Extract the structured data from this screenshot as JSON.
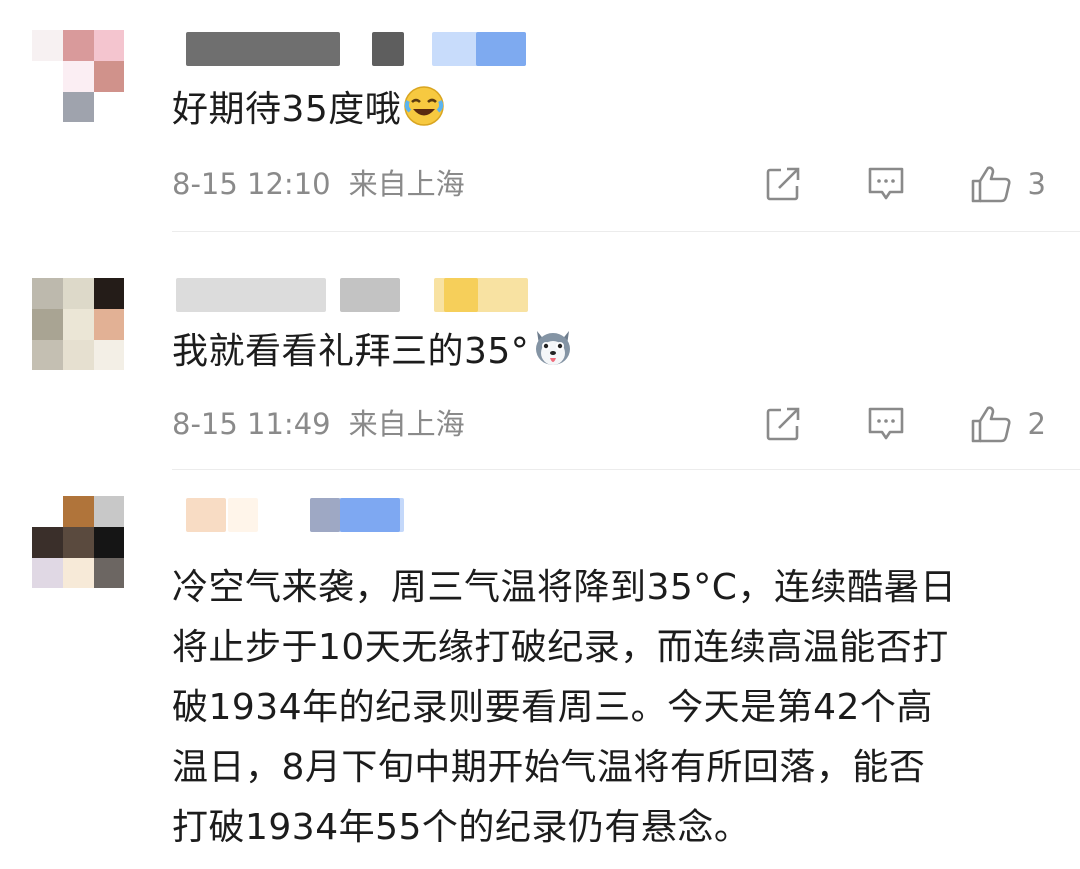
{
  "comments": [
    {
      "text": "好期待35度哦",
      "emoji": "laughing-crying-emoji",
      "time": "8-15 12:10",
      "location": "来自上海",
      "likes": "3"
    },
    {
      "text": "我就看看礼拜三的35°",
      "emoji": "husky-dog-emoji",
      "time": "8-15 11:49",
      "location": "来自上海",
      "likes": "2"
    },
    {
      "lines": [
        "冷空气来袭，周三气温将降到35°C，连续酷暑日",
        "将止步于10天无缘打破纪录，而连续高温能否打",
        "破1934年的纪录则要看周三。今天是第42个高",
        "温日，8月下旬中期开始气温将有所回落，能否",
        "打破1934年55个的纪录仍有悬念。"
      ]
    }
  ],
  "icons": {
    "share": "share-icon",
    "reply": "comment-icon",
    "like": "thumbs-up-icon"
  },
  "colors": {
    "meta": "#8a8a8a",
    "text": "#1c1c1c",
    "divider": "#ececec"
  }
}
